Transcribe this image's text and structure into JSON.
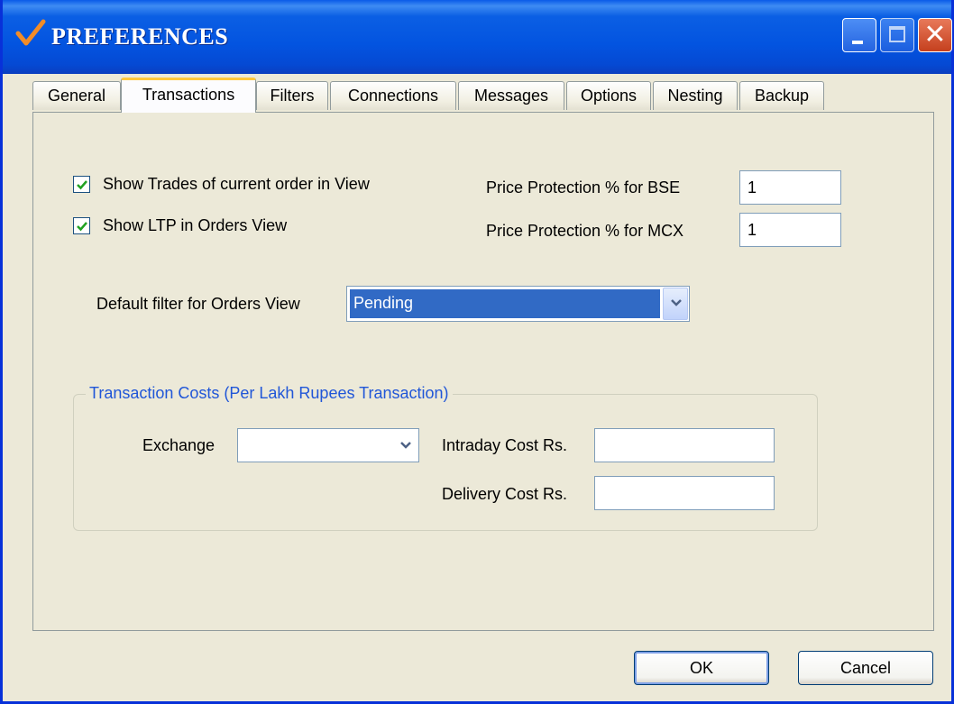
{
  "window": {
    "title": "PREFERENCES"
  },
  "tabs": [
    {
      "label": "General",
      "active": false
    },
    {
      "label": "Transactions",
      "active": true
    },
    {
      "label": "Filters",
      "active": false
    },
    {
      "label": "Connections",
      "active": false
    },
    {
      "label": "Messages",
      "active": false
    },
    {
      "label": "Options",
      "active": false
    },
    {
      "label": "Nesting",
      "active": false
    },
    {
      "label": "Backup",
      "active": false
    }
  ],
  "transactions": {
    "show_trades": {
      "label": "Show Trades of current order in View",
      "checked": true
    },
    "show_ltp": {
      "label": "Show LTP in Orders View",
      "checked": true
    },
    "price_bse": {
      "label": "Price Protection % for BSE",
      "value": "1"
    },
    "price_mcx": {
      "label": "Price Protection % for MCX",
      "value": "1"
    },
    "default_filter": {
      "label": "Default filter for Orders View",
      "value": "Pending"
    },
    "costs": {
      "title": "Transaction Costs (Per Lakh Rupees Transaction)",
      "exchange": {
        "label": "Exchange",
        "value": ""
      },
      "intraday": {
        "label": "Intraday Cost Rs.",
        "value": ""
      },
      "delivery": {
        "label": "Delivery Cost Rs.",
        "value": ""
      }
    }
  },
  "buttons": {
    "ok": "OK",
    "cancel": "Cancel"
  },
  "colors": {
    "titlebar": "#0354e0",
    "selection": "#316ac5",
    "group_title": "#2056d8",
    "active_tab_accent": "#ffc83c"
  },
  "icons": {
    "title": "checkmark-icon",
    "minimize": "minimize-icon",
    "maximize": "maximize-icon",
    "close": "close-icon",
    "dropdown": "chevron-down-icon"
  }
}
